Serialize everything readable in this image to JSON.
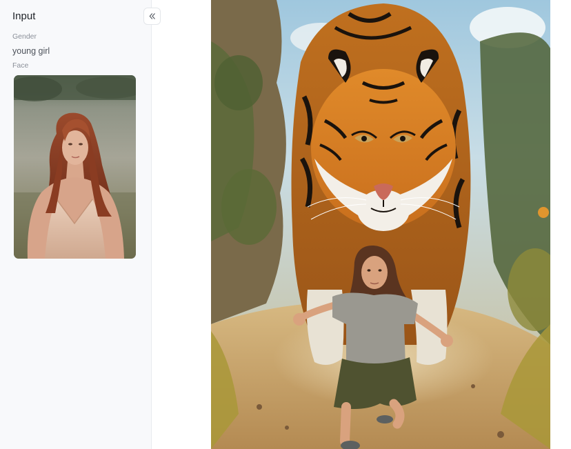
{
  "panel": {
    "title": "Input",
    "gender_label": "Gender",
    "gender_value": "young girl",
    "face_label": "Face"
  },
  "icons": {
    "collapse": "double-chevron-left-icon"
  },
  "colors": {
    "panel_bg": "#f8f9fb",
    "border": "#e8eaee",
    "title_text": "#1f2328",
    "label_text": "#8a8f98"
  }
}
